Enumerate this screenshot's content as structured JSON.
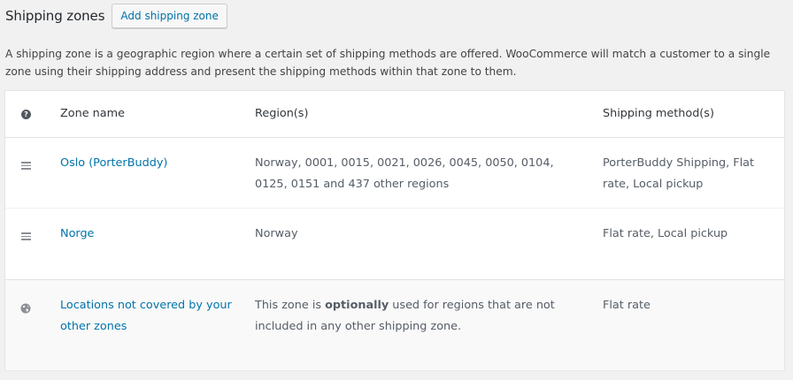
{
  "header": {
    "title": "Shipping zones",
    "add_button_label": "Add shipping zone"
  },
  "intro_text": "A shipping zone is a geographic region where a certain set of shipping methods are offered. WooCommerce will match a customer to a single zone using their shipping address and present the shipping methods within that zone to them.",
  "table": {
    "help_icon": "question-circle-icon",
    "columns": {
      "name": "Zone name",
      "regions": "Region(s)",
      "methods": "Shipping method(s)"
    },
    "zones": [
      {
        "icon": "drag-handle-icon",
        "name": "Oslo (PorterBuddy)",
        "regions": "Norway, 0001, 0015, 0021, 0026, 0045, 0050, 0104, 0125, 0151 and 437 other regions",
        "methods": "PorterBuddy Shipping, Flat rate, Local pickup"
      },
      {
        "icon": "drag-handle-icon",
        "name": "Norge",
        "regions": "Norway",
        "methods": "Flat rate, Local pickup"
      }
    ],
    "default_zone": {
      "icon": "globe-icon",
      "name": "Locations not covered by your other zones",
      "desc_before": "This zone is ",
      "desc_emphasis": "optionally",
      "desc_after": " used for regions that are not included in any other shipping zone.",
      "methods": "Flat rate"
    }
  },
  "colors": {
    "link": "#0073aa",
    "background": "#f1f1f1",
    "text": "#32373c"
  }
}
